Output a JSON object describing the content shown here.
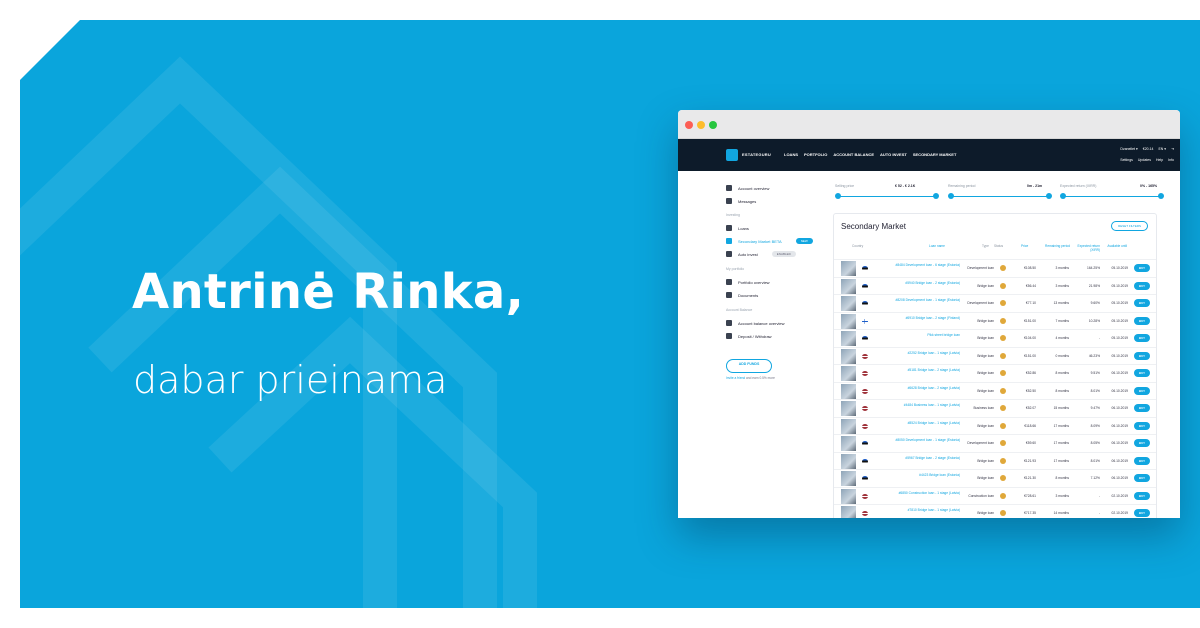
{
  "banner": {
    "headline": "Antrinė Rinka,",
    "subline": "dabar prieinama",
    "background_color": "#0aa5dc"
  },
  "browser": {
    "nav": {
      "brand": "ESTATEGURU",
      "links": [
        "LOANS",
        "PORTFOLIO",
        "ACCOUNT BALANCE",
        "AUTO INVEST",
        "SECONDARY MARKET"
      ],
      "right_top": [
        "Dzanellet ▾",
        "€20.14",
        "EN ▾"
      ],
      "right_bottom": [
        "Settings",
        "Updates",
        "Help",
        "Info"
      ]
    },
    "sidebar": {
      "items": [
        {
          "label": "Account overview",
          "icon": "grid-icon"
        },
        {
          "label": "Messages",
          "icon": "mail-icon"
        }
      ],
      "section_investing": "Investing",
      "investing_items": [
        {
          "label": "Loans",
          "icon": "loans-icon"
        },
        {
          "label": "Secondary Market BETA",
          "icon": "cart-icon",
          "badge": "NEW"
        },
        {
          "label": "Auto invest",
          "icon": "auto-icon",
          "badge": "ENABLED"
        }
      ],
      "section_portfolio": "My portfolio",
      "portfolio_items": [
        {
          "label": "Portfolio overview",
          "icon": "briefcase-icon"
        },
        {
          "label": "Documents",
          "icon": "folder-icon"
        }
      ],
      "section_balance": "Account Balance",
      "balance_items": [
        {
          "label": "Account balance overview",
          "icon": "bank-icon"
        },
        {
          "label": "Deposit / Withdraw",
          "icon": "transfer-icon"
        }
      ],
      "add_funds": "ADD FUNDS",
      "invite_link": "Invite a friend",
      "invite_rest": " and earn 0.5% more"
    },
    "filters": [
      {
        "label": "Selling price",
        "value": "€ 52 - € 2.1K"
      },
      {
        "label": "Remaining period",
        "value": "0m - 21m"
      },
      {
        "label": "Expected return (XIRR)",
        "value": "0% - 165%"
      }
    ],
    "market": {
      "title": "Secondary Market",
      "reset_label": "RESET FILTERS",
      "columns": [
        "Country",
        "Loan name",
        "Type",
        "Status",
        "Price",
        "Remaining period",
        "Expected return (XIRR)",
        "Available until"
      ],
      "buy_label": "BUY",
      "rows": [
        {
          "loan": "#8484 Development loan - 6 stage (Estonia)",
          "type": "Development loan",
          "price": "€108.50",
          "period": "3 months",
          "ret": "164.25%",
          "until": "05.10.2019",
          "flag": "ee"
        },
        {
          "loan": "#5940 Bridge loan - 2 stage (Estonia)",
          "type": "Bridge loan",
          "price": "€56.44",
          "period": "3 months",
          "ret": "21.98%",
          "until": "05.10.2019",
          "flag": "ee"
        },
        {
          "loan": "#8208 Development loan - 1 stage (Estonia)",
          "type": "Development loan",
          "price": "€77.10",
          "period": "13 months",
          "ret": "9.60%",
          "until": "05.10.2019",
          "flag": "ee"
        },
        {
          "loan": "#6910 Bridge loan - 2 stage (Finland)",
          "type": "Bridge loan",
          "price": "€151.00",
          "period": "7 months",
          "ret": "10.28%",
          "until": "05.10.2019",
          "flag": "fi"
        },
        {
          "loan": "Pikk street bridge loan",
          "type": "Bridge loan",
          "price": "€104.00",
          "period": "4 months",
          "ret": "-",
          "until": "05.10.2019",
          "flag": "ee"
        },
        {
          "loan": "#2252 Bridge loan - 1 stage (Latvia)",
          "type": "Bridge loan",
          "price": "€151.00",
          "period": "0 months",
          "ret": "46.23%",
          "until": "05.10.2019",
          "flag": "lv"
        },
        {
          "loan": "#5181 Bridge loan - 2 stage (Latvia)",
          "type": "Bridge loan",
          "price": "€52.86",
          "period": "8 months",
          "ret": "9.51%",
          "until": "06.10.2019",
          "flag": "lv"
        },
        {
          "loan": "#6628 Bridge loan - 2 stage (Latvia)",
          "type": "Bridge loan",
          "price": "€52.50",
          "period": "8 months",
          "ret": "8.01%",
          "until": "06.10.2019",
          "flag": "lv"
        },
        {
          "loan": "#4484 Business loan - 1 stage (Latvia)",
          "type": "Business loan",
          "price": "€52.07",
          "period": "15 months",
          "ret": "9.47%",
          "until": "06.10.2019",
          "flag": "lv"
        },
        {
          "loan": "#8524 Bridge loan - 1 stage (Latvia)",
          "type": "Bridge loan",
          "price": "€118.66",
          "period": "17 months",
          "ret": "8.09%",
          "until": "06.10.2019",
          "flag": "lv"
        },
        {
          "loan": "#8050 Development loan - 1 stage (Estonia)",
          "type": "Development loan",
          "price": "€59.60",
          "period": "17 months",
          "ret": "8.05%",
          "until": "06.10.2019",
          "flag": "ee"
        },
        {
          "loan": "#5967 Bridge loan - 2 stage (Estonia)",
          "type": "Bridge loan",
          "price": "€121.93",
          "period": "17 months",
          "ret": "8.01%",
          "until": "06.10.2019",
          "flag": "ee"
        },
        {
          "loan": "#4423 Bridge loan (Estonia)",
          "type": "Bridge loan",
          "price": "€121.30",
          "period": "8 months",
          "ret": "7.12%",
          "until": "06.10.2019",
          "flag": "ee"
        },
        {
          "loan": "#6850 Construction loan - 1 stage (Latvia)",
          "type": "Construction loan",
          "price": "€728.61",
          "period": "3 months",
          "ret": "-",
          "until": "02.10.2019",
          "flag": "lv"
        },
        {
          "loan": "#7810 Bridge loan - 1 stage (Latvia)",
          "type": "Bridge loan",
          "price": "€717.35",
          "period": "14 months",
          "ret": "-",
          "until": "02.10.2019",
          "flag": "lv"
        }
      ]
    }
  }
}
